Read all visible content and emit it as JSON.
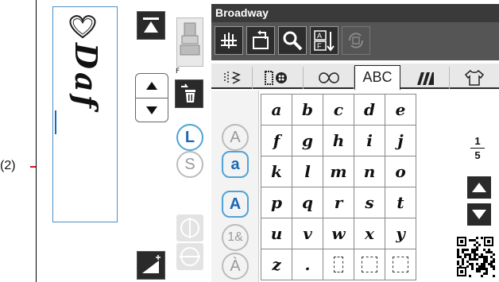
{
  "callout": {
    "label": "(2)"
  },
  "preview": {
    "text": "Daf"
  },
  "pressfoot": {
    "label": "F"
  },
  "mode_buttons": {
    "large": "L",
    "small": "S"
  },
  "window": {
    "title": "Broadway"
  },
  "tabs": [
    {
      "label": "",
      "icon": "stitch-zigzag-icon"
    },
    {
      "label": "",
      "icon": "button-hole-icon"
    },
    {
      "label": "",
      "icon": "decorative-stitch-icon"
    },
    {
      "label": "ABC",
      "icon": ""
    },
    {
      "label": "",
      "icon": "satin-stitch-icon"
    },
    {
      "label": "",
      "icon": "garment-icon"
    }
  ],
  "case_buttons": {
    "upper": "A",
    "lower": "a",
    "upper_bold": "A",
    "numbers": "1&",
    "accented": "À"
  },
  "keys": [
    [
      "a",
      "b",
      "c",
      "d",
      "e"
    ],
    [
      "f",
      "g",
      "h",
      "i",
      "j"
    ],
    [
      "k",
      "l",
      "m",
      "n",
      "o"
    ],
    [
      "p",
      "q",
      "r",
      "s",
      "t"
    ],
    [
      "u",
      "v",
      "w",
      "x",
      "y"
    ],
    [
      "z",
      ".",
      "",
      "",
      ""
    ]
  ],
  "page": {
    "current": "1",
    "total": "5"
  },
  "colors": {
    "accent": "#4fa3d6",
    "callout": "#d9131c",
    "titlebar": "#3a3a3a"
  }
}
